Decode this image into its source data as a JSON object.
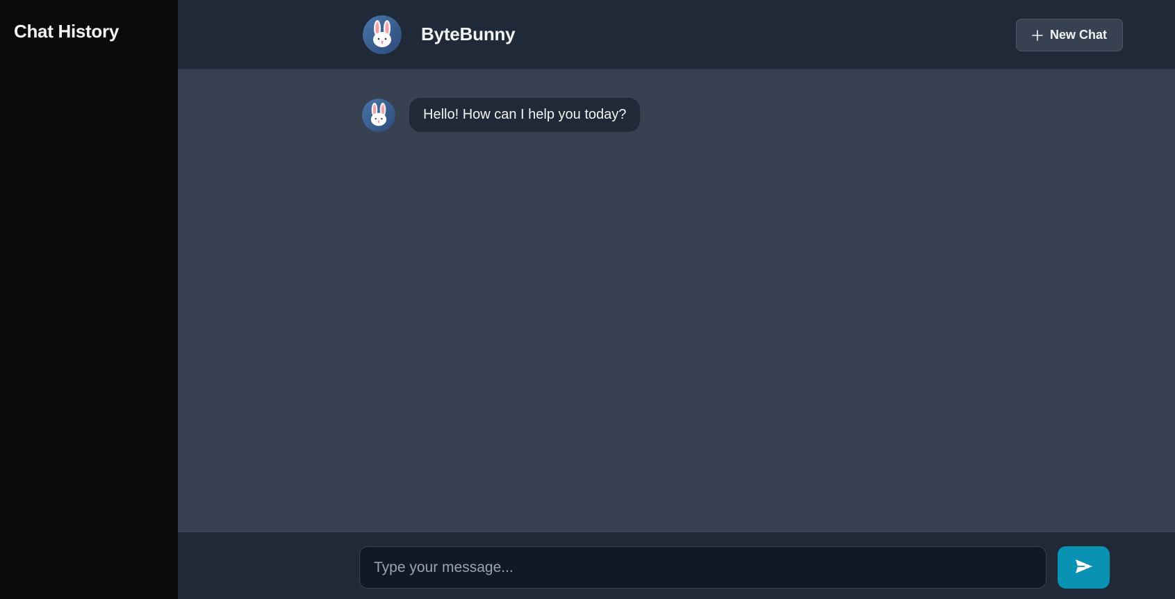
{
  "sidebar": {
    "title": "Chat History"
  },
  "header": {
    "bot_name": "ByteBunny",
    "avatar_icon": "bunny-icon",
    "new_chat_label": "New Chat",
    "new_chat_icon": "plus-icon"
  },
  "messages": [
    {
      "sender": "bot",
      "avatar_icon": "bunny-icon",
      "text": "Hello! How can I help you today?"
    }
  ],
  "composer": {
    "placeholder": "Type your message...",
    "value": "",
    "send_icon": "send-icon"
  },
  "colors": {
    "sidebar_bg": "#0a0a0a",
    "header_bg": "#1f2937",
    "chat_bg": "#374151",
    "bubble_bg": "#1f2937",
    "input_bg": "#111827",
    "accent": "#0891b2",
    "avatar_bg": "#3b5f8f"
  }
}
